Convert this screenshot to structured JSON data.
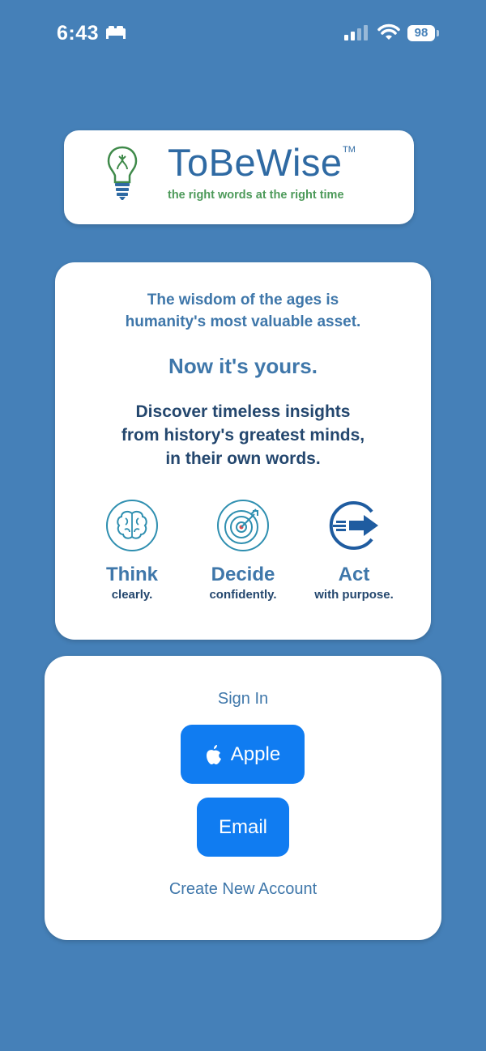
{
  "status_bar": {
    "time": "6:43",
    "battery": "98"
  },
  "logo": {
    "brand": "ToBeWise",
    "tm": "TM",
    "tagline": "the right words at the right time"
  },
  "intro": {
    "line1": "The wisdom of the ages is",
    "line2": "humanity's most valuable asset.",
    "headline": "Now it's yours.",
    "discover1": "Discover timeless insights",
    "discover2": "from history's greatest minds,",
    "discover3": "in their own words."
  },
  "features": [
    {
      "title": "Think",
      "sub": "clearly.",
      "icon": "brain-icon"
    },
    {
      "title": "Decide",
      "sub": "confidently.",
      "icon": "target-icon"
    },
    {
      "title": "Act",
      "sub": "with purpose.",
      "icon": "arrow-icon"
    }
  ],
  "signin": {
    "title": "Sign In",
    "apple_label": "Apple",
    "email_label": "Email",
    "create_label": "Create New Account"
  },
  "colors": {
    "background": "#4580b8",
    "accent": "#107cf1",
    "brand_blue": "#2f6aa3",
    "tagline_green": "#4d9a5a"
  }
}
